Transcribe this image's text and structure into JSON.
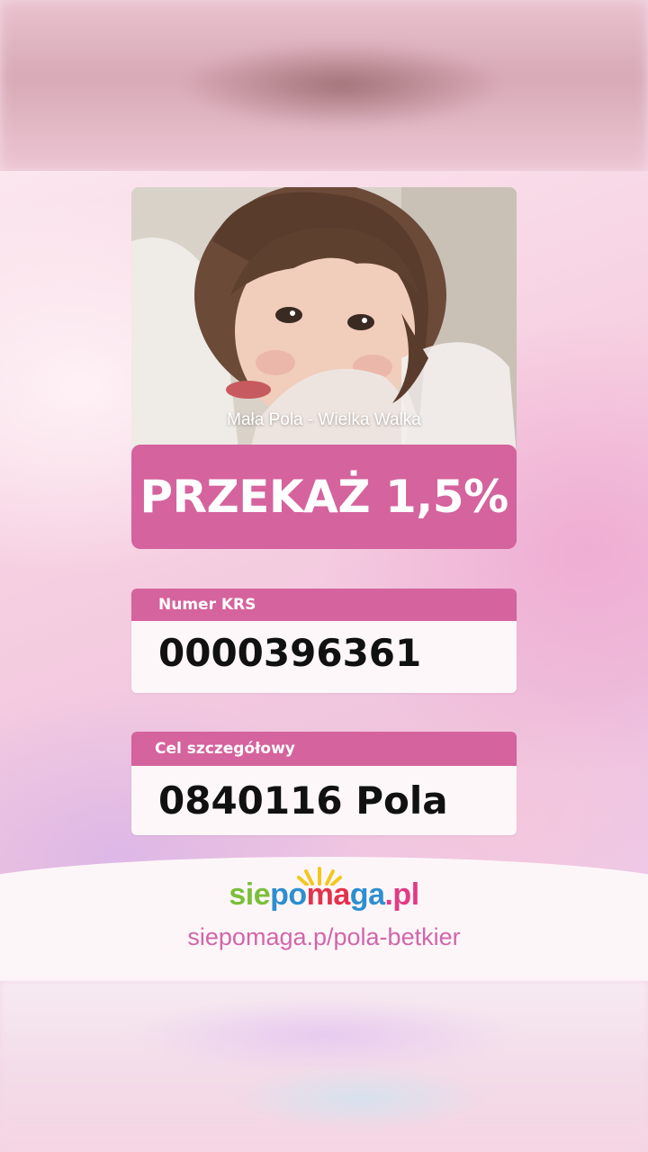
{
  "post": {
    "caption": "Mała Pola - Wielka Walka",
    "cta": "PRZEKAŻ 1,5%",
    "krs": {
      "label": "Numer KRS",
      "value": "0000396361"
    },
    "goal": {
      "label": "Cel szczegółowy",
      "value": "0840116 Pola"
    },
    "logo": {
      "part1": "sie",
      "part2": "po",
      "part3": "ma",
      "part4": "ga",
      "part5": ".pl"
    },
    "url": "siepomaga.p/pola-betkier"
  },
  "colors": {
    "accent": "#d5639d",
    "url": "#d166a8",
    "card_bg": "#fdf7fa"
  }
}
